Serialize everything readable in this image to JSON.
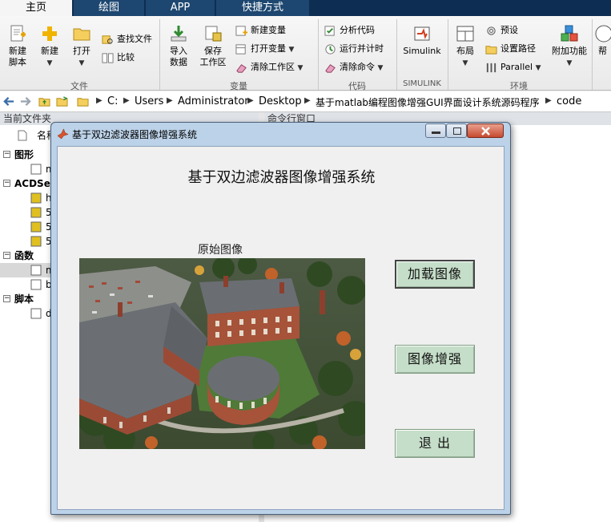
{
  "ribbon_tabs": [
    "主页",
    "绘图",
    "APP",
    "快捷方式"
  ],
  "ribbon": {
    "file_group": {
      "label": "文件",
      "new_script": "新建\n脚本",
      "new": "新建",
      "open": "打开",
      "find_files": "查找文件",
      "compare": "比较"
    },
    "variable_group": {
      "label": "变量",
      "import_data": "导入\n数据",
      "save_workspace": "保存\n工作区",
      "new_variable": "新建变量",
      "open_variable": "打开变量",
      "clear_workspace": "清除工作区"
    },
    "code_group": {
      "label": "代码",
      "analyze_code": "分析代码",
      "run_and_time": "运行并计时",
      "clear_commands": "清除命令"
    },
    "simulink_group": {
      "label": "SIMULINK",
      "simulink": "Simulink"
    },
    "environment_group": {
      "label": "环境",
      "layout": "布局",
      "preferences": "预设",
      "set_path": "设置路径",
      "parallel": "Parallel",
      "addons": "附加功能",
      "help_partial": "帮"
    }
  },
  "address": {
    "crumbs": [
      "C:",
      "Users",
      "Administrator",
      "Desktop",
      "基于matlab编程图像增强GUI界面设计系统源码程序",
      "code"
    ]
  },
  "panels": {
    "current_folder": "当前文件夹",
    "command_window": "命令行窗口",
    "name_col": "名称"
  },
  "tree": [
    {
      "type": "group",
      "label": "图形"
    },
    {
      "type": "item",
      "label": "m"
    },
    {
      "type": "group",
      "label": "ACDSee"
    },
    {
      "type": "item",
      "label": "h"
    },
    {
      "type": "item",
      "label": "5"
    },
    {
      "type": "item",
      "label": "5"
    },
    {
      "type": "item",
      "label": "5"
    },
    {
      "type": "group",
      "label": "函数"
    },
    {
      "type": "item",
      "label": "m"
    },
    {
      "type": "item",
      "label": "b"
    },
    {
      "type": "group",
      "label": "脚本"
    },
    {
      "type": "item",
      "label": "d"
    }
  ],
  "gui": {
    "window_title": "基于双边滤波器图像增强系统",
    "heading": "基于双边滤波器图像增强系统",
    "image_label": "原始图像",
    "buttons": {
      "load": "加载图像",
      "enhance": "图像增强",
      "exit": "退 出"
    }
  },
  "colors": {
    "tab_bar": "#0e2d52",
    "gui_button": "#c5dec9",
    "window_frame": "#bcd2e8"
  }
}
